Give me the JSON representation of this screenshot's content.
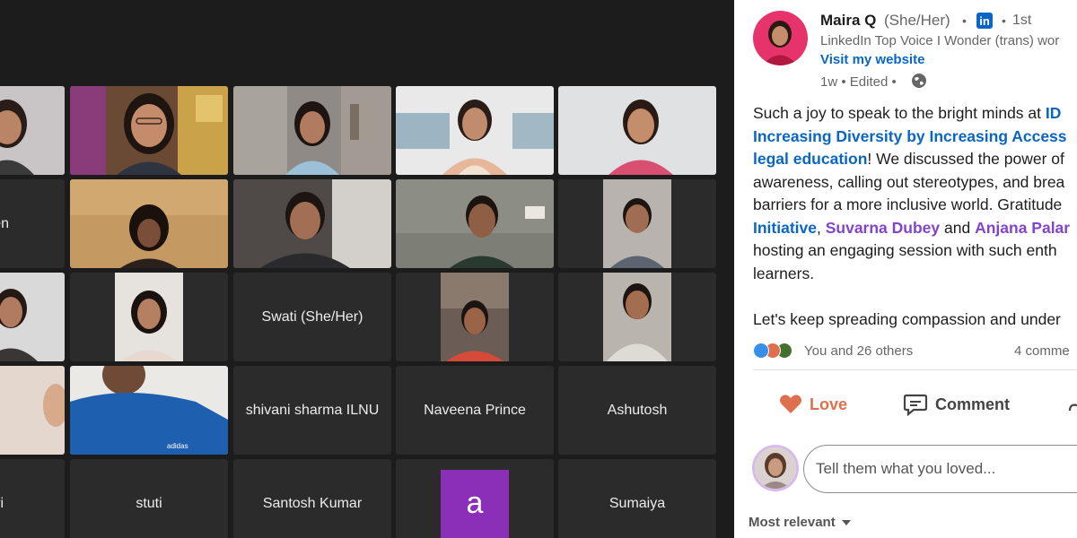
{
  "call": {
    "participants": [
      {
        "name": "",
        "kind": "video"
      },
      {
        "name": "",
        "kind": "video",
        "active": true
      },
      {
        "name": "",
        "kind": "video"
      },
      {
        "name": "",
        "kind": "video"
      },
      {
        "name": "",
        "kind": "video"
      },
      {
        "name": "en",
        "kind": "name"
      },
      {
        "name": "",
        "kind": "video"
      },
      {
        "name": "",
        "kind": "video"
      },
      {
        "name": "",
        "kind": "video"
      },
      {
        "name": "",
        "kind": "video"
      },
      {
        "name": "",
        "kind": "video"
      },
      {
        "name": "",
        "kind": "video"
      },
      {
        "name": "Swati (She/Her)",
        "kind": "name"
      },
      {
        "name": "",
        "kind": "video"
      },
      {
        "name": "",
        "kind": "video"
      },
      {
        "name": "",
        "kind": "video"
      },
      {
        "name": "",
        "kind": "video"
      },
      {
        "name": "shivani sharma ILNU",
        "kind": "name"
      },
      {
        "name": "Naveena Prince",
        "kind": "name"
      },
      {
        "name": "Ashutosh",
        "kind": "name"
      },
      {
        "name": "umari",
        "kind": "name"
      },
      {
        "name": "stuti",
        "kind": "name"
      },
      {
        "name": "Santosh Kumar",
        "kind": "name"
      },
      {
        "name": "a",
        "kind": "letter",
        "color": "#8b2fb8"
      },
      {
        "name": "Sumaiya",
        "kind": "name"
      }
    ]
  },
  "post": {
    "author": {
      "name": "Maira Q",
      "pronouns": "(She/Her)",
      "degree": "1st",
      "headline": "LinkedIn Top Voice I Wonder (trans) wor",
      "website": "Visit my website",
      "age": "1w",
      "edited": "Edited"
    },
    "body": {
      "l1a": "Such a joy to speak to the bright minds at ",
      "l1b": "ID",
      "l2": "Increasing Diversity by Increasing Access",
      "l3a": "legal education",
      "l3b": "! We discussed the power of",
      "l4": "awareness, calling out stereotypes, and brea",
      "l5": "barriers for a more inclusive world. Gratitude",
      "l6a": "Initiative",
      "l6b": ", ",
      "l6c": "Suvarna Dubey",
      "l6d": " and ",
      "l6e": "Anjana Palar",
      "l7": "hosting an engaging session with such enth",
      "l8": "learners.",
      "l9": "Let's keep spreading compassion and under"
    },
    "reactions": {
      "summary": "You and 26 others",
      "comments": "4 comme",
      "icons": [
        "like-icon",
        "love-icon",
        "celebrate-icon"
      ],
      "colors": {
        "like": "#378fe9",
        "love": "#df704d",
        "celebrate": "#44712e"
      }
    },
    "actions": {
      "love": "Love",
      "comment": "Comment"
    },
    "comment_box": {
      "placeholder": "Tell them what you loved..."
    },
    "sort": {
      "label": "Most relevant"
    },
    "colors": {
      "link_blue": "#0a66c2",
      "mention_purple": "#8344cc",
      "love_orange": "#df704d"
    }
  }
}
